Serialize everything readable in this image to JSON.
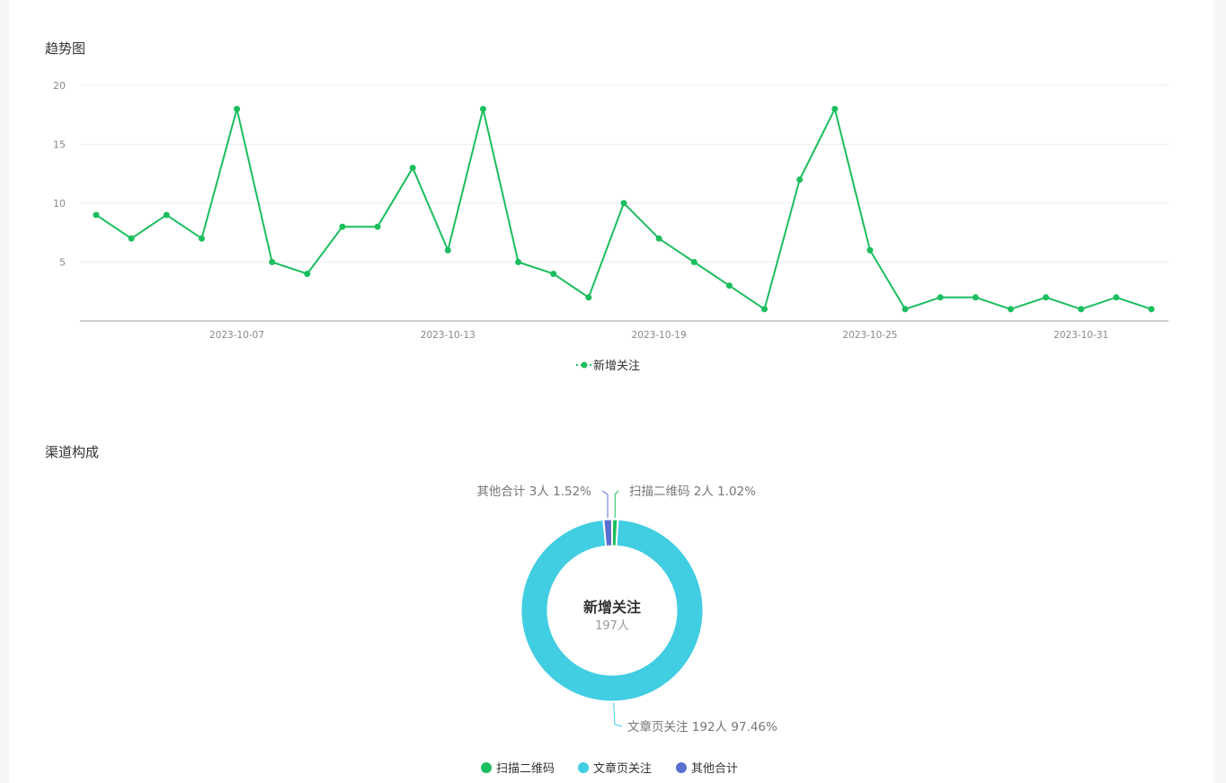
{
  "colors": {
    "green": "#1bbe5e",
    "cyan": "#41cde2",
    "purple": "#5b6fd0"
  },
  "trend_section": {
    "title": "趋势图"
  },
  "channel_section": {
    "title": "渠道构成"
  },
  "chart_data": [
    {
      "type": "line",
      "y_ticks": [
        "5",
        "10",
        "15",
        "20"
      ],
      "ylim": [
        0,
        20
      ],
      "x_tick_labels": [
        "2023-10-07",
        "2023-10-13",
        "2023-10-19",
        "2023-10-25",
        "2023-10-31"
      ],
      "x": [
        "2023-10-03",
        "2023-10-04",
        "2023-10-05",
        "2023-10-06",
        "2023-10-07",
        "2023-10-08",
        "2023-10-09",
        "2023-10-10",
        "2023-10-11",
        "2023-10-12",
        "2023-10-13",
        "2023-10-14",
        "2023-10-15",
        "2023-10-16",
        "2023-10-17",
        "2023-10-18",
        "2023-10-19",
        "2023-10-20",
        "2023-10-21",
        "2023-10-22",
        "2023-10-23",
        "2023-10-24",
        "2023-10-25",
        "2023-10-26",
        "2023-10-27",
        "2023-10-28",
        "2023-10-29",
        "2023-10-30",
        "2023-10-31",
        "2023-11-01",
        "2023-11-02"
      ],
      "series": [
        {
          "name": "新增关注",
          "color": "#1bbe5e",
          "values": [
            9,
            7,
            9,
            7,
            18,
            5,
            4,
            8,
            8,
            13,
            6,
            18,
            5,
            4,
            2,
            10,
            7,
            5,
            3,
            1,
            12,
            18,
            6,
            1,
            2,
            2,
            1,
            2,
            1,
            2,
            1
          ]
        }
      ],
      "grid": true,
      "legend_position": "bottom-center"
    },
    {
      "type": "pie",
      "variant": "donut",
      "center_title": "新增关注",
      "center_subtitle": "197人",
      "slices": [
        {
          "name": "扫描二维码",
          "value": 2,
          "percent": "1.02%",
          "color": "#1bbe5e",
          "label": "扫描二维码 2人 1.02%"
        },
        {
          "name": "文章页关注",
          "value": 192,
          "percent": "97.46%",
          "color": "#41cde2",
          "label": "文章页关注 192人 97.46%"
        },
        {
          "name": "其他合计",
          "value": 3,
          "percent": "1.52%",
          "color": "#5b6fd0",
          "label": "其他合计 3人 1.52%"
        }
      ],
      "legend_position": "bottom-center"
    }
  ]
}
